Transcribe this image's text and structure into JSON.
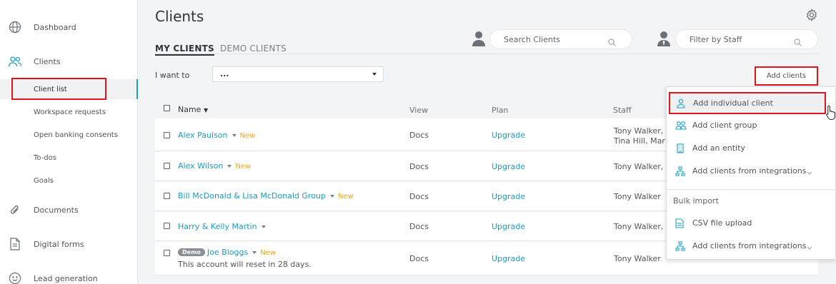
{
  "sidebar": {
    "main_items": [
      {
        "label": "Dashboard",
        "icon": "globe-icon"
      },
      {
        "label": "Clients",
        "icon": "users-icon"
      },
      {
        "label": "Documents",
        "icon": "paperclip-icon"
      },
      {
        "label": "Digital forms",
        "icon": "document-icon"
      },
      {
        "label": "Lead generation",
        "icon": "smiley-icon"
      }
    ],
    "sub_items": [
      {
        "label": "Client list"
      },
      {
        "label": "Workspace requests"
      },
      {
        "label": "Open banking consents"
      },
      {
        "label": "To-dos"
      },
      {
        "label": "Goals"
      }
    ]
  },
  "header": {
    "title": "Clients",
    "tabs": [
      {
        "label": "MY CLIENTS"
      },
      {
        "label": "DEMO CLIENTS"
      }
    ],
    "search_placeholder": "Search Clients",
    "staff_filter_placeholder": "Filter by Staff"
  },
  "toolbar": {
    "i_want_to_label": "I want to",
    "action_select_value": "...",
    "add_clients_label": "Add clients"
  },
  "table": {
    "columns": {
      "name": "Name",
      "view": "View",
      "plan": "Plan",
      "staff": "Staff"
    },
    "rows": [
      {
        "name": "Alex Paulson",
        "badge": "New",
        "view": "Docs",
        "plan": "Upgrade",
        "staff_line1": "Tony Walker, I",
        "staff_line2": "Tina Hill, Mari"
      },
      {
        "name": "Alex Wilson",
        "badge": "New",
        "view": "Docs",
        "plan": "Upgrade",
        "staff_line1": "Tony Walker, I",
        "staff_line2": ""
      },
      {
        "name": "Bill McDonald & Lisa McDonald Group",
        "badge": "New",
        "view": "Docs",
        "plan": "Upgrade",
        "staff_line1": "Tony Walker",
        "staff_line2": ""
      },
      {
        "name": "Harry & Kelly Martin",
        "badge": "",
        "view": "Docs",
        "plan": "Upgrade",
        "staff_line1": "Tony Walker, I",
        "staff_line2": ""
      },
      {
        "name": "Joe Bloggs",
        "badge": "New",
        "demo": "Demo",
        "note": "This account will reset in 28 days.",
        "view": "Docs",
        "plan": "Upgrade",
        "staff_line1": "Tony Walker",
        "staff_line2": ""
      }
    ]
  },
  "add_clients_menu": {
    "items": [
      {
        "label": "Add individual client",
        "icon": "person-icon"
      },
      {
        "label": "Add client group",
        "icon": "group-icon"
      },
      {
        "label": "Add an entity",
        "icon": "building-icon"
      },
      {
        "label": "Add clients from integrations",
        "icon": "network-icon"
      }
    ],
    "bulk_heading": "Bulk import",
    "bulk_items": [
      {
        "label": "CSV file upload",
        "icon": "file-icon"
      },
      {
        "label": "Add clients from integrations",
        "icon": "network-icon"
      }
    ]
  },
  "colors": {
    "accent": "#1aa3c4",
    "new_badge": "#f2a516",
    "highlight": "#e0141a"
  }
}
